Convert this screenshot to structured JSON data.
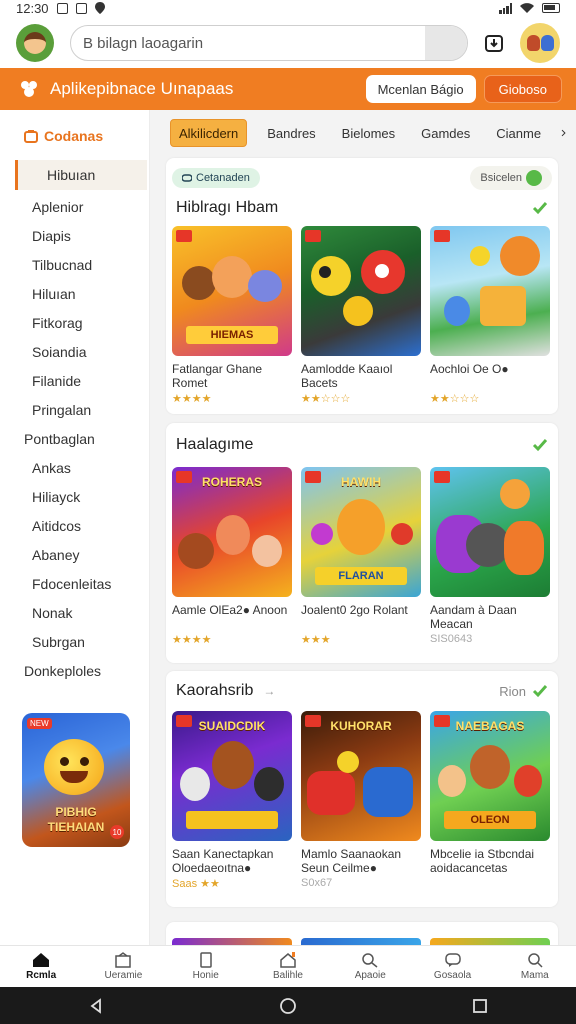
{
  "status_bar": {
    "time": "12:30"
  },
  "top_bar": {
    "search_value": "B bilagn laoagarin"
  },
  "orange_bar": {
    "title": "Aplikepibnace Uınapaas",
    "button1": "Mcenlan Bágio",
    "button2": "Gioboso"
  },
  "sidebar": {
    "header": "Codanas",
    "items": [
      {
        "label": "Hibuıan",
        "active": true
      },
      {
        "label": "Aplenior"
      },
      {
        "label": "Diapis"
      },
      {
        "label": "Tilbucnad"
      },
      {
        "label": "Hiluıan"
      },
      {
        "label": "Fitkorag"
      },
      {
        "label": "Soiandia"
      },
      {
        "label": "Filanide"
      },
      {
        "label": "Pringalan"
      },
      {
        "label": "Pontbaglan",
        "group": true
      },
      {
        "label": "Ankas"
      },
      {
        "label": "Hiliayck"
      },
      {
        "label": "Aitidcos"
      },
      {
        "label": "Abaney"
      },
      {
        "label": "Fdocenleitas"
      },
      {
        "label": "Nonak"
      },
      {
        "label": "Subrgan"
      },
      {
        "label": "Donkeploles",
        "group": true
      }
    ],
    "promo": {
      "text": "PIBHIG TIEHAIAN",
      "badge": "NEW",
      "count": "10"
    }
  },
  "main": {
    "tabs": [
      "Alkilicdern",
      "Bandres",
      "Bielomes",
      "Gamdes",
      "Cianme"
    ],
    "sections": [
      {
        "chips": {
          "left": "Cetanaden",
          "right": "Bsicelen"
        },
        "title": "Hiblragı Hbam",
        "more": "",
        "cards": [
          {
            "name": "Fatlangar Ghane Romet",
            "meta": "★★★★",
            "grey": false,
            "thumb_title": "",
            "banner": "HIEMAS"
          },
          {
            "name": "Aamlodde Kaaıol Bacets",
            "meta": "★★☆☆☆",
            "grey": false,
            "thumb_title": "",
            "banner": ""
          },
          {
            "name": "Aochloi Oe O●",
            "meta": "★★☆☆☆",
            "grey": false,
            "thumb_title": "",
            "banner": ""
          }
        ]
      },
      {
        "title": "Haalagıme",
        "more": "",
        "cards": [
          {
            "name": "Aamle OlEa2● Anoon",
            "meta": "★★★★",
            "grey": false,
            "thumb_title": "ROHERAS",
            "banner": ""
          },
          {
            "name": "Joalent0 2go Rolant",
            "meta": "★★★",
            "grey": false,
            "thumb_title": "HAWIH",
            "banner": "FLARAN"
          },
          {
            "name": "Aandam à Daan Meacan",
            "meta": "SIS0643",
            "grey": true,
            "thumb_title": "",
            "banner": ""
          }
        ]
      },
      {
        "title": "Kaorahsrib",
        "more": "Rion",
        "cards": [
          {
            "name": "Saan Kanectapkan Oloedaeoıtna●",
            "meta": "Saas ★★",
            "grey": false,
            "thumb_title": "SUAIDCDIK",
            "banner": ""
          },
          {
            "name": "Mamlo Saanaokan Seun Ceilme●",
            "meta": "S0x67",
            "grey": true,
            "thumb_title": "KUHORAR",
            "banner": ""
          },
          {
            "name": "Mbcelie ia Stbcndai aoidacancetas",
            "meta": "",
            "grey": true,
            "thumb_title": "NAEBAGAS",
            "banner": "OLEON"
          }
        ]
      }
    ]
  },
  "bottom_nav": [
    "Rcmla",
    "Ueramie",
    "Honie",
    "Balihle",
    "Apaoie",
    "Gosaola",
    "Mama"
  ],
  "colors": {
    "accent": "#f07d22",
    "active_tab": "#f5b041",
    "check": "#58b947"
  }
}
